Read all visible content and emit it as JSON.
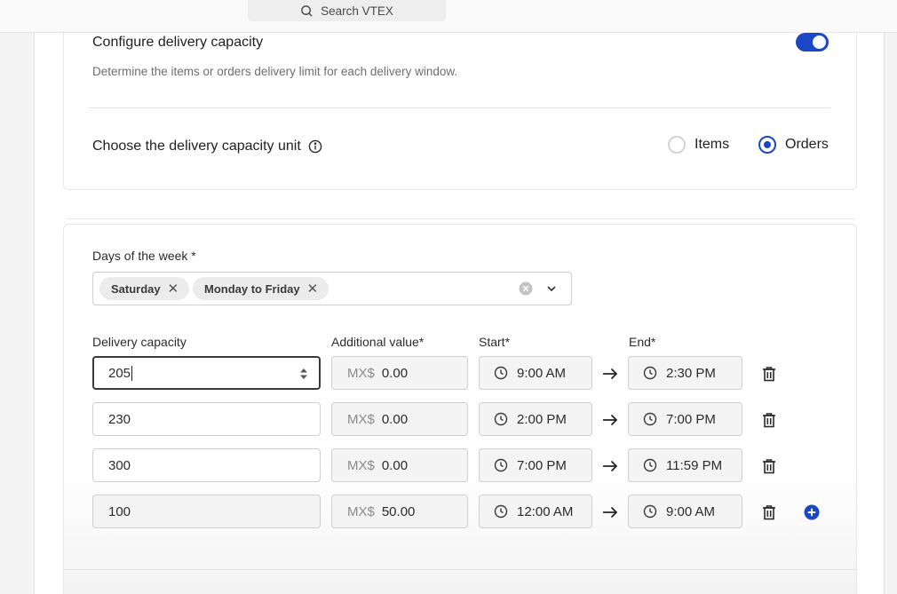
{
  "header": {
    "search_placeholder": "Search VTEX"
  },
  "capacity": {
    "title": "Configure delivery capacity",
    "description": "Determine the items or orders delivery limit for each delivery window.",
    "toggle_on": true,
    "unit_label": "Choose the delivery capacity unit",
    "unit_options": [
      {
        "label": "Items",
        "selected": false
      },
      {
        "label": "Orders",
        "selected": true
      }
    ]
  },
  "window": {
    "days_label": "Days of the week *",
    "days_selected": [
      "Saturday",
      "Monday to Friday"
    ],
    "columns": {
      "capacity": "Delivery capacity",
      "additional": "Additional value*",
      "start": "Start*",
      "end": "End*"
    },
    "currency_prefix": "MX$",
    "rows": [
      {
        "capacity": "205",
        "additional": "0.00",
        "start": "9:00 AM",
        "end": "2:30 PM"
      },
      {
        "capacity": "230",
        "additional": "0.00",
        "start": "2:00 PM",
        "end": "7:00 PM"
      },
      {
        "capacity": "300",
        "additional": "0.00",
        "start": "7:00 PM",
        "end": "11:59 PM"
      },
      {
        "capacity": "100",
        "additional": "50.00",
        "start": "12:00 AM",
        "end": "9:00 AM"
      }
    ]
  },
  "colors": {
    "accent": "#1a47c5"
  }
}
